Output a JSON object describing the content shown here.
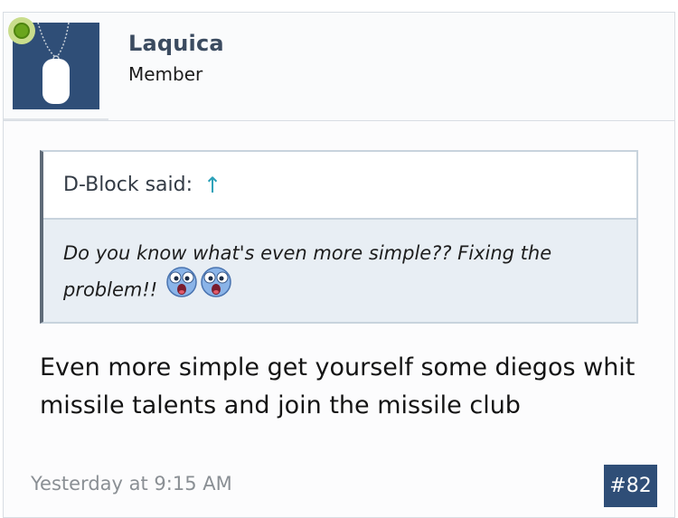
{
  "post": {
    "user": {
      "name": "Laquica",
      "title": "Member",
      "online": true
    },
    "quote": {
      "attribution": "D-Block said:",
      "jump_symbol": "↑",
      "text": "Do you know what's even more simple?? Fixing the problem!!",
      "emoji": [
        "eek-smiley-icon",
        "eek-smiley-icon"
      ]
    },
    "message": "Even more simple get yourself some diegos whit missile talents and join the missile club",
    "date": "Yesterday at 9:15 AM",
    "number": "#82"
  },
  "colors": {
    "accent": "#2f4e77",
    "username": "#3b4b60",
    "quote_bg": "#e8eef4",
    "online": "#6aa51d",
    "link": "#2aa0b8"
  }
}
